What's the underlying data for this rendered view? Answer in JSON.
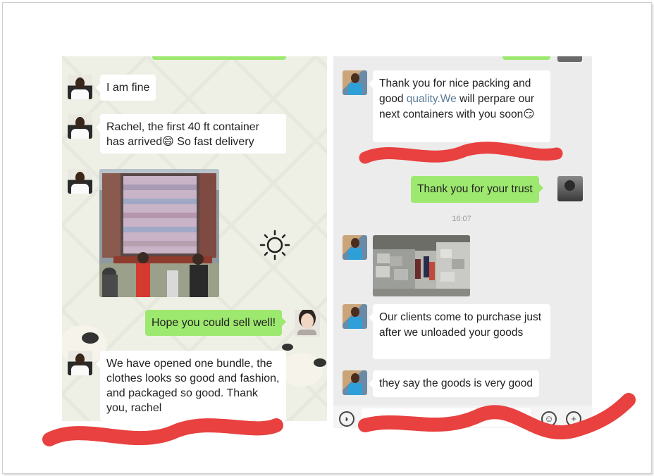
{
  "left_chat": {
    "messages": [
      {
        "side": "in",
        "text": "I am fine"
      },
      {
        "side": "in",
        "text": "Rachel, the first 40 ft container has arrived😄 So fast delivery"
      },
      {
        "side": "in",
        "type": "image",
        "image": "container-photo"
      },
      {
        "side": "out",
        "text": "Hope you could sell well!"
      },
      {
        "side": "in",
        "text": "We have opened one bundle, the clothes looks so good and fashion, and packaged so good. Thank you, rachel"
      }
    ]
  },
  "right_chat": {
    "messages": [
      {
        "side": "in",
        "text_before": "Thank you for nice packing and good ",
        "link": "quality.We",
        "text_after": " will perpare our next containers with you soon😏"
      },
      {
        "side": "out",
        "text": "Thank you for your trust"
      },
      {
        "type": "time",
        "text": "16:07"
      },
      {
        "side": "in",
        "type": "image",
        "image": "bales-photo"
      },
      {
        "side": "in",
        "text": "Our clients come to purchase just after we unloaded your goods"
      },
      {
        "side": "in",
        "text": "they say the goods is very good"
      }
    ],
    "toolbar": {
      "voice_icon": "voice-icon",
      "emoji_icon": "emoji-icon",
      "plus_icon": "plus-icon"
    }
  },
  "colors": {
    "outgoing_bubble": "#9de86e",
    "incoming_bubble": "#ffffff",
    "left_background": "#eef0e6",
    "right_background": "#ececec",
    "scribble": "#e8413f",
    "link": "#5b7c99"
  }
}
